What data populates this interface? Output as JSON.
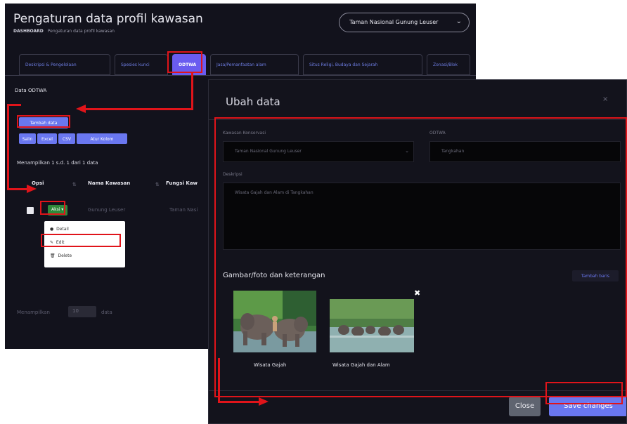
{
  "page": {
    "title": "Pengaturan data profil kawasan",
    "breadcrumb": [
      "DASHBOARD",
      "Pengaturan data profil kawasan"
    ],
    "region_select": "Taman Nasional Gunung Leuser"
  },
  "tabs": [
    {
      "label": "Deskripsi & Pengelolaan"
    },
    {
      "label": "Spesies kunci"
    },
    {
      "label": "ODTWA",
      "active": true
    },
    {
      "label": "Jasa/Pemanfaatan alam"
    },
    {
      "label": "Situs Religi, Budaya dan Sejarah"
    },
    {
      "label": "Zonasi/Blok"
    }
  ],
  "list": {
    "section_label": "Data ODTWA",
    "add_button": "Tambah data",
    "export_buttons": [
      "Salin",
      "Excel",
      "CSV",
      "Atur Kolom"
    ],
    "showing_text": "Menampilkan 1 s.d. 1 dari 1 data",
    "columns": [
      "Opsi",
      "Nama Kawasan",
      "Fungsi Kaw"
    ],
    "row": {
      "aksi": "Aksi",
      "nama_kawasan": "Gunung Leuser",
      "fungsi": "Taman Nasi"
    },
    "dropdown": [
      "Detail",
      "Edit",
      "Delete"
    ],
    "per_page_label": "Menampilkan",
    "per_page_value": "10",
    "per_page_suffix": "data"
  },
  "modal": {
    "title": "Ubah data",
    "close_icon": "×",
    "kawasan_label": "Kawasan Konservasi",
    "kawasan_value": "Taman Nasional Gunung Leuser",
    "odtwa_label": "ODTWA",
    "odtwa_value": "Tangkahan",
    "deskripsi_label": "Deskripsi",
    "deskripsi_value": "Wisata Gajah dan Alam di Tangkahan",
    "gallery_title": "Gambar/foto dan keterangan",
    "add_image_button": "Tambah baris",
    "images": [
      {
        "caption": "Wisata Gajah"
      },
      {
        "caption": "Wisata Gajah dan Alam"
      }
    ],
    "remove_image_icon": "✖",
    "close_button": "Close",
    "save_button": "Save changes"
  },
  "colors": {
    "annotation": "#e0141a",
    "accent": "#6a77f0",
    "active_tab": "#6a5cf0",
    "background": "#12121c"
  }
}
